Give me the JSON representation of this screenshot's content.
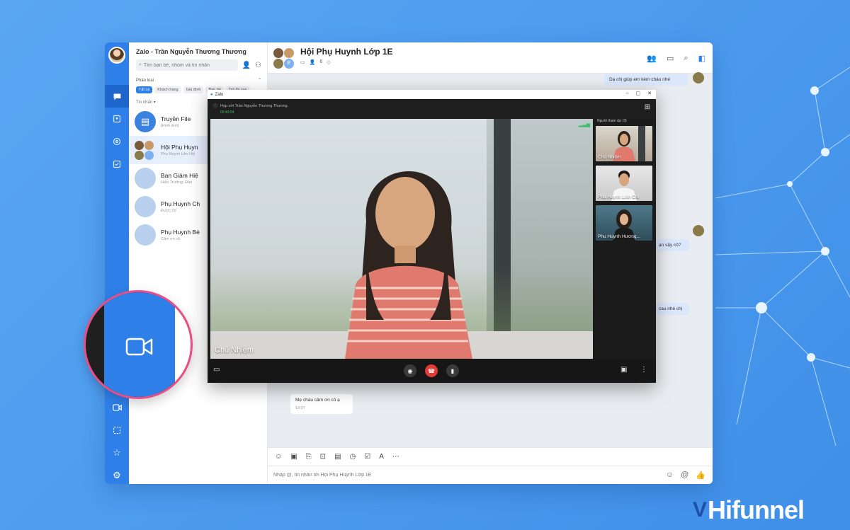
{
  "app": {
    "title": "Zalo - Trần Nguyễn Thương Thương",
    "search_placeholder": "Tìm bạn bè, nhóm và tin nhắn",
    "filter_label": "Phân loại",
    "chips": [
      "Tất cả",
      "Khách hàng",
      "Gia đình",
      "Bạn bè",
      "Trả lời sau"
    ],
    "section_label": "Tin nhắn ▾"
  },
  "conversations": [
    {
      "name": "Truyền File",
      "sub": "[Hình ảnh]"
    },
    {
      "name": "Hội Phụ Huyn",
      "sub": "Phụ Huynh Lớn Hội"
    },
    {
      "name": "Ban Giám Hiệ",
      "sub": "Hiệu Trưởng: Đảo"
    },
    {
      "name": "Phụ Huynh Ch",
      "sub": "Được rồi"
    },
    {
      "name": "Phụ Huynh Bé",
      "sub": "Cảm ơn cô"
    }
  ],
  "chat": {
    "title": "Hội Phụ Huynh Lớp 1E",
    "member_count": "6",
    "badge": "E",
    "messages": [
      "Dạ chị giúp em kèm cháu nhé",
      "ạn vậy cô?",
      "cau nhé chị",
      "Mẹ cháu cảm ơn cô ạ"
    ],
    "message_time": "13:07",
    "input_placeholder": "Nhập @, tin nhắn tới Hội Phụ Huynh Lớp 1E"
  },
  "call": {
    "window_title": "Zalo",
    "call_name": "Họp với Trần Nguyễn Thương Thương",
    "call_time": "00:43:04",
    "main_participant": "Chủ Nhiệm",
    "participants_title": "Người tham dự (3)",
    "participants": [
      "Chủ Nhiệm",
      "Phụ Huynh Linh Chi",
      "Phụ Huynh Hương..."
    ]
  },
  "brand": {
    "name": "Hifunnel",
    "v": "V"
  },
  "colors": {
    "accent": "#2f7fe8",
    "end_call": "#e53935",
    "highlight_ring": "#e94f86"
  },
  "icons": [
    "chat-icon",
    "contacts-icon",
    "at-icon",
    "todo-icon",
    "video-icon",
    "screen-icon",
    "star-icon",
    "settings-icon",
    "phone-end-icon",
    "mic-icon",
    "camera-icon"
  ]
}
